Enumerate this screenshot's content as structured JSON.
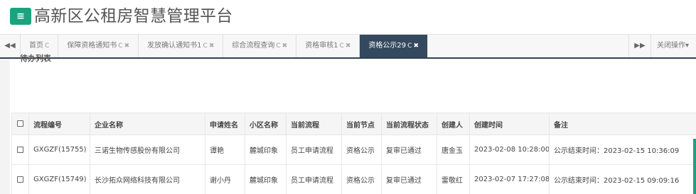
{
  "header": {
    "menu_icon": "hamburger-menu-icon",
    "title": "高新区公租房智慧管理平台",
    "accent_color": "#1aa37e"
  },
  "tabbar": {
    "left_nav_icon": "double-chevron-left-icon",
    "right_nav_icon": "double-chevron-right-icon",
    "close_ops_label": "关闭操作▾",
    "tabs": [
      {
        "label": "首页",
        "refresh": "C",
        "close": ""
      },
      {
        "label": "保障资格通知书",
        "refresh": "C",
        "close": "✖"
      },
      {
        "label": "发放确认通知书1",
        "refresh": "C",
        "close": "✖"
      },
      {
        "label": "综合流程查询",
        "refresh": "C",
        "close": "✖"
      },
      {
        "label": "资格审核1",
        "refresh": "C",
        "close": "✖"
      },
      {
        "label": "资格公示29",
        "refresh": "C",
        "close": "✖"
      }
    ],
    "active_color": "#34495e"
  },
  "panel": {
    "title": "待办列表"
  },
  "table": {
    "columns": [
      "流程编号",
      "企业名称",
      "申请姓名",
      "小区名称",
      "当前流程",
      "当前节点",
      "当前流程状态",
      "创建人",
      "创建时间",
      "备注"
    ],
    "rows": [
      [
        "GXGZF(15755)",
        "三诺生物传感股份有限公司",
        "谭艳",
        "麓城印象",
        "员工申请流程",
        "资格公示",
        "复审已通过",
        "唐金玉",
        "2023-02-08 10:28:00",
        "公示结束时间：2023-02-15 10:36:09"
      ],
      [
        "GXGZF(15749)",
        "长沙拓众网络科技有限公司",
        "谢小丹",
        "麓城印象",
        "员工申请流程",
        "资格公示",
        "复审已通过",
        "雷敬红",
        "2023-02-07 17:27:08",
        "公示结束时间：2023-02-15 09:09:16"
      ]
    ]
  }
}
